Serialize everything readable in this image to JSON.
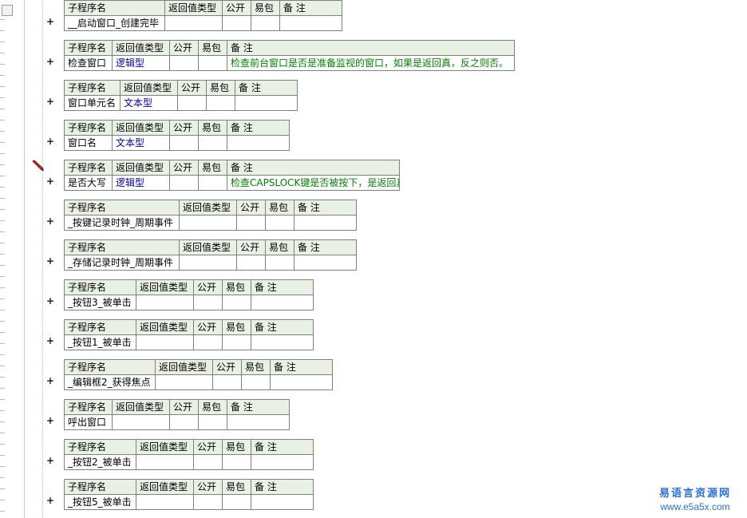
{
  "headers": {
    "name": "子程序名",
    "ret": "返回值类型",
    "pub": "公开",
    "easy": "易包",
    "note": "备 注"
  },
  "plus_symbol": "+",
  "colors": {
    "header_bg": "#e9f1e4",
    "border": "#808080",
    "type_text": "#0000a0",
    "note_text": "#008000",
    "watermark": "#2b6fd6"
  },
  "subprograms": [
    {
      "name": "__启动窗口_创建完毕",
      "ret": "",
      "note": ""
    },
    {
      "name": "检查窗口",
      "ret": "逻辑型",
      "note": "检查前台窗口是否是准备监视的窗口，如果是返回真，反之则否。"
    },
    {
      "name": "窗口单元名",
      "ret": "文本型",
      "note": ""
    },
    {
      "name": "窗口名",
      "ret": "文本型",
      "note": ""
    },
    {
      "name": "是否大写",
      "ret": "逻辑型",
      "note": "检查CAPSLOCK键是否被按下，是返回真"
    },
    {
      "name": "_按键记录时钟_周期事件",
      "ret": "",
      "note": ""
    },
    {
      "name": "_存储记录时钟_周期事件",
      "ret": "",
      "note": ""
    },
    {
      "name": "_按钮3_被单击",
      "ret": "",
      "note": ""
    },
    {
      "name": "_按钮1_被单击",
      "ret": "",
      "note": ""
    },
    {
      "name": "_编辑框2_获得焦点",
      "ret": "",
      "note": ""
    },
    {
      "name": "呼出窗口",
      "ret": "",
      "note": ""
    },
    {
      "name": "_按钮2_被单击",
      "ret": "",
      "note": ""
    },
    {
      "name": "_按钮5_被单击",
      "ret": "",
      "note": ""
    }
  ],
  "watermark": {
    "cn": "易语言资源网",
    "url": "www.e5a5x.com"
  }
}
